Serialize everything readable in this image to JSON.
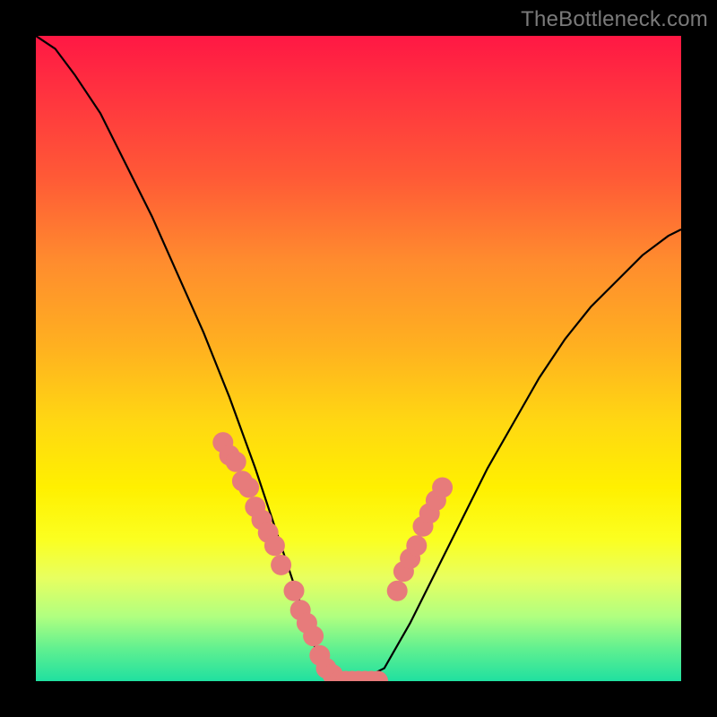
{
  "watermark": "TheBottleneck.com",
  "chart_data": {
    "type": "line",
    "title": "",
    "xlabel": "",
    "ylabel": "",
    "xlim": [
      0,
      100
    ],
    "ylim": [
      0,
      100
    ],
    "grid": false,
    "background_gradient": {
      "top": "#ff1844",
      "middle": "#ffd812",
      "bottom": "#20e0a0"
    },
    "curve_black": {
      "comment": "V-shaped bottleneck curve; values are height% above baseline at given x%",
      "x": [
        0,
        3,
        6,
        10,
        14,
        18,
        22,
        26,
        30,
        34,
        37,
        40,
        42,
        44,
        46,
        50,
        54,
        58,
        62,
        66,
        70,
        74,
        78,
        82,
        86,
        90,
        94,
        98,
        100
      ],
      "y": [
        100,
        98,
        94,
        88,
        80,
        72,
        63,
        54,
        44,
        33,
        24,
        15,
        9,
        3,
        0,
        0,
        2,
        9,
        17,
        25,
        33,
        40,
        47,
        53,
        58,
        62,
        66,
        69,
        70
      ]
    },
    "markers_pink": {
      "color": "#e77b7b",
      "radius_pct": 1.6,
      "left_cluster": {
        "x": [
          29,
          30,
          31,
          32,
          33,
          34,
          35,
          36,
          37,
          38,
          40,
          41,
          42,
          43,
          44,
          45,
          46,
          47,
          48,
          49,
          50,
          51,
          52,
          53
        ],
        "y": [
          37,
          35,
          34,
          31,
          30,
          27,
          25,
          23,
          21,
          18,
          14,
          11,
          9,
          7,
          4,
          2,
          1,
          0,
          0,
          0,
          0,
          0,
          0,
          0
        ]
      },
      "right_cluster": {
        "x": [
          56,
          57,
          58,
          59,
          60,
          61,
          62,
          63
        ],
        "y": [
          14,
          17,
          19,
          21,
          24,
          26,
          28,
          30
        ]
      }
    }
  }
}
